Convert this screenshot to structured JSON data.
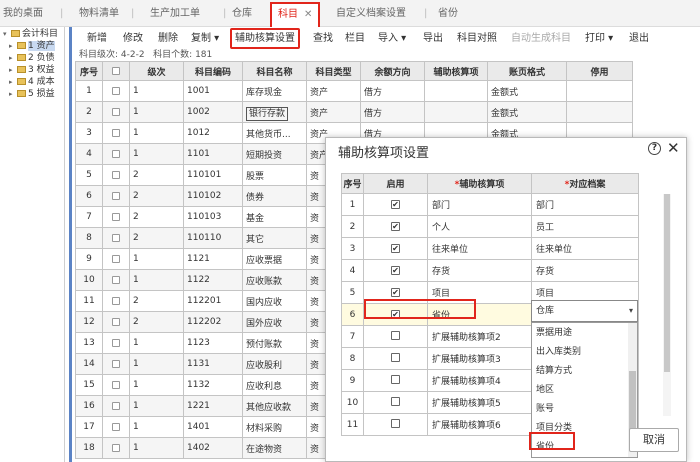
{
  "tabs": [
    {
      "label": "我的桌面",
      "active": false
    },
    {
      "label": "物料清单",
      "active": false
    },
    {
      "label": "生产加工单",
      "active": false
    },
    {
      "label": "仓库",
      "active": false
    },
    {
      "label": "科目",
      "active": true
    },
    {
      "label": "自定义档案设置",
      "active": false
    },
    {
      "label": "省份",
      "active": false
    }
  ],
  "tree": {
    "root": "会计科目",
    "items": [
      "1 资产",
      "2 负债",
      "3 权益",
      "4 成本",
      "5 损益"
    ]
  },
  "toolbar": {
    "new": "新增",
    "edit": "修改",
    "delete": "删除",
    "copy": "复制",
    "aux_setup": "辅助核算设置",
    "find": "查找",
    "columns": "栏目",
    "import": "导入",
    "export": "导出",
    "compare": "科目对照",
    "auto_gen": "自动生成科目",
    "print": "打印",
    "exit": "退出"
  },
  "info": {
    "levels": "科目级次:  4-2-2",
    "count": "科目个数:  181"
  },
  "grid": {
    "headers": [
      "序号",
      "",
      "级次",
      "科目编码",
      "科目名称",
      "科目类型",
      "余额方向",
      "辅助核算项",
      "账页格式",
      "停用"
    ],
    "rows": [
      [
        "1",
        "1",
        "1001",
        "库存现金",
        "资产",
        "借方",
        "",
        "金额式"
      ],
      [
        "2",
        "1",
        "1002",
        "银行存款",
        "资产",
        "借方",
        "",
        "金额式"
      ],
      [
        "3",
        "1",
        "1012",
        "其他货币...",
        "资产",
        "借方",
        "",
        "金额式"
      ],
      [
        "4",
        "1",
        "1101",
        "短期投资",
        "资产",
        "",
        "",
        ""
      ],
      [
        "5",
        "2",
        "110101",
        "股票",
        "资",
        "",
        "",
        ""
      ],
      [
        "6",
        "2",
        "110102",
        "债券",
        "资",
        "",
        "",
        ""
      ],
      [
        "7",
        "2",
        "110103",
        "基金",
        "资",
        "",
        "",
        ""
      ],
      [
        "8",
        "2",
        "110110",
        "其它",
        "资",
        "",
        "",
        ""
      ],
      [
        "9",
        "1",
        "1121",
        "应收票据",
        "资",
        "",
        "",
        ""
      ],
      [
        "10",
        "1",
        "1122",
        "应收账款",
        "资",
        "",
        "",
        ""
      ],
      [
        "11",
        "2",
        "112201",
        "国内应收",
        "资",
        "",
        "",
        ""
      ],
      [
        "12",
        "2",
        "112202",
        "国外应收",
        "资",
        "",
        "",
        ""
      ],
      [
        "13",
        "1",
        "1123",
        "预付账款",
        "资",
        "",
        "",
        ""
      ],
      [
        "14",
        "1",
        "1131",
        "应收股利",
        "资",
        "",
        "",
        ""
      ],
      [
        "15",
        "1",
        "1132",
        "应收利息",
        "资",
        "",
        "",
        ""
      ],
      [
        "16",
        "1",
        "1221",
        "其他应收款",
        "资",
        "",
        "",
        ""
      ],
      [
        "17",
        "1",
        "1401",
        "材料采购",
        "资",
        "",
        "",
        ""
      ],
      [
        "18",
        "1",
        "1402",
        "在途物资",
        "资",
        "",
        "",
        ""
      ]
    ]
  },
  "dialog": {
    "title": "辅助核算项设置",
    "headers": {
      "seq": "序号",
      "enabled": "启用",
      "aux": "辅助核算项",
      "archive": "对应档案"
    },
    "rows": [
      {
        "seq": "1",
        "checked": true,
        "aux": "部门",
        "archive": "部门"
      },
      {
        "seq": "2",
        "checked": true,
        "aux": "个人",
        "archive": "员工"
      },
      {
        "seq": "3",
        "checked": true,
        "aux": "往来单位",
        "archive": "往来单位"
      },
      {
        "seq": "4",
        "checked": true,
        "aux": "存货",
        "archive": "存货"
      },
      {
        "seq": "5",
        "checked": true,
        "aux": "项目",
        "archive": "项目"
      },
      {
        "seq": "6",
        "checked": true,
        "aux": "省份",
        "archive": ""
      },
      {
        "seq": "7",
        "checked": false,
        "aux": "扩展辅助核算项2",
        "archive": ""
      },
      {
        "seq": "8",
        "checked": false,
        "aux": "扩展辅助核算项3",
        "archive": ""
      },
      {
        "seq": "9",
        "checked": false,
        "aux": "扩展辅助核算项4",
        "archive": ""
      },
      {
        "seq": "10",
        "checked": false,
        "aux": "扩展辅助核算项5",
        "archive": ""
      },
      {
        "seq": "11",
        "checked": false,
        "aux": "扩展辅助核算项6",
        "archive": ""
      }
    ],
    "select_value": "仓库",
    "dropdown_options": [
      "票据用途",
      "出入库类别",
      "结算方式",
      "地区",
      "账号",
      "项目分类",
      "省份"
    ],
    "cancel": "取消"
  },
  "colors": {
    "accent_red": "#e1251b",
    "divider_blue": "#5b83c5"
  }
}
